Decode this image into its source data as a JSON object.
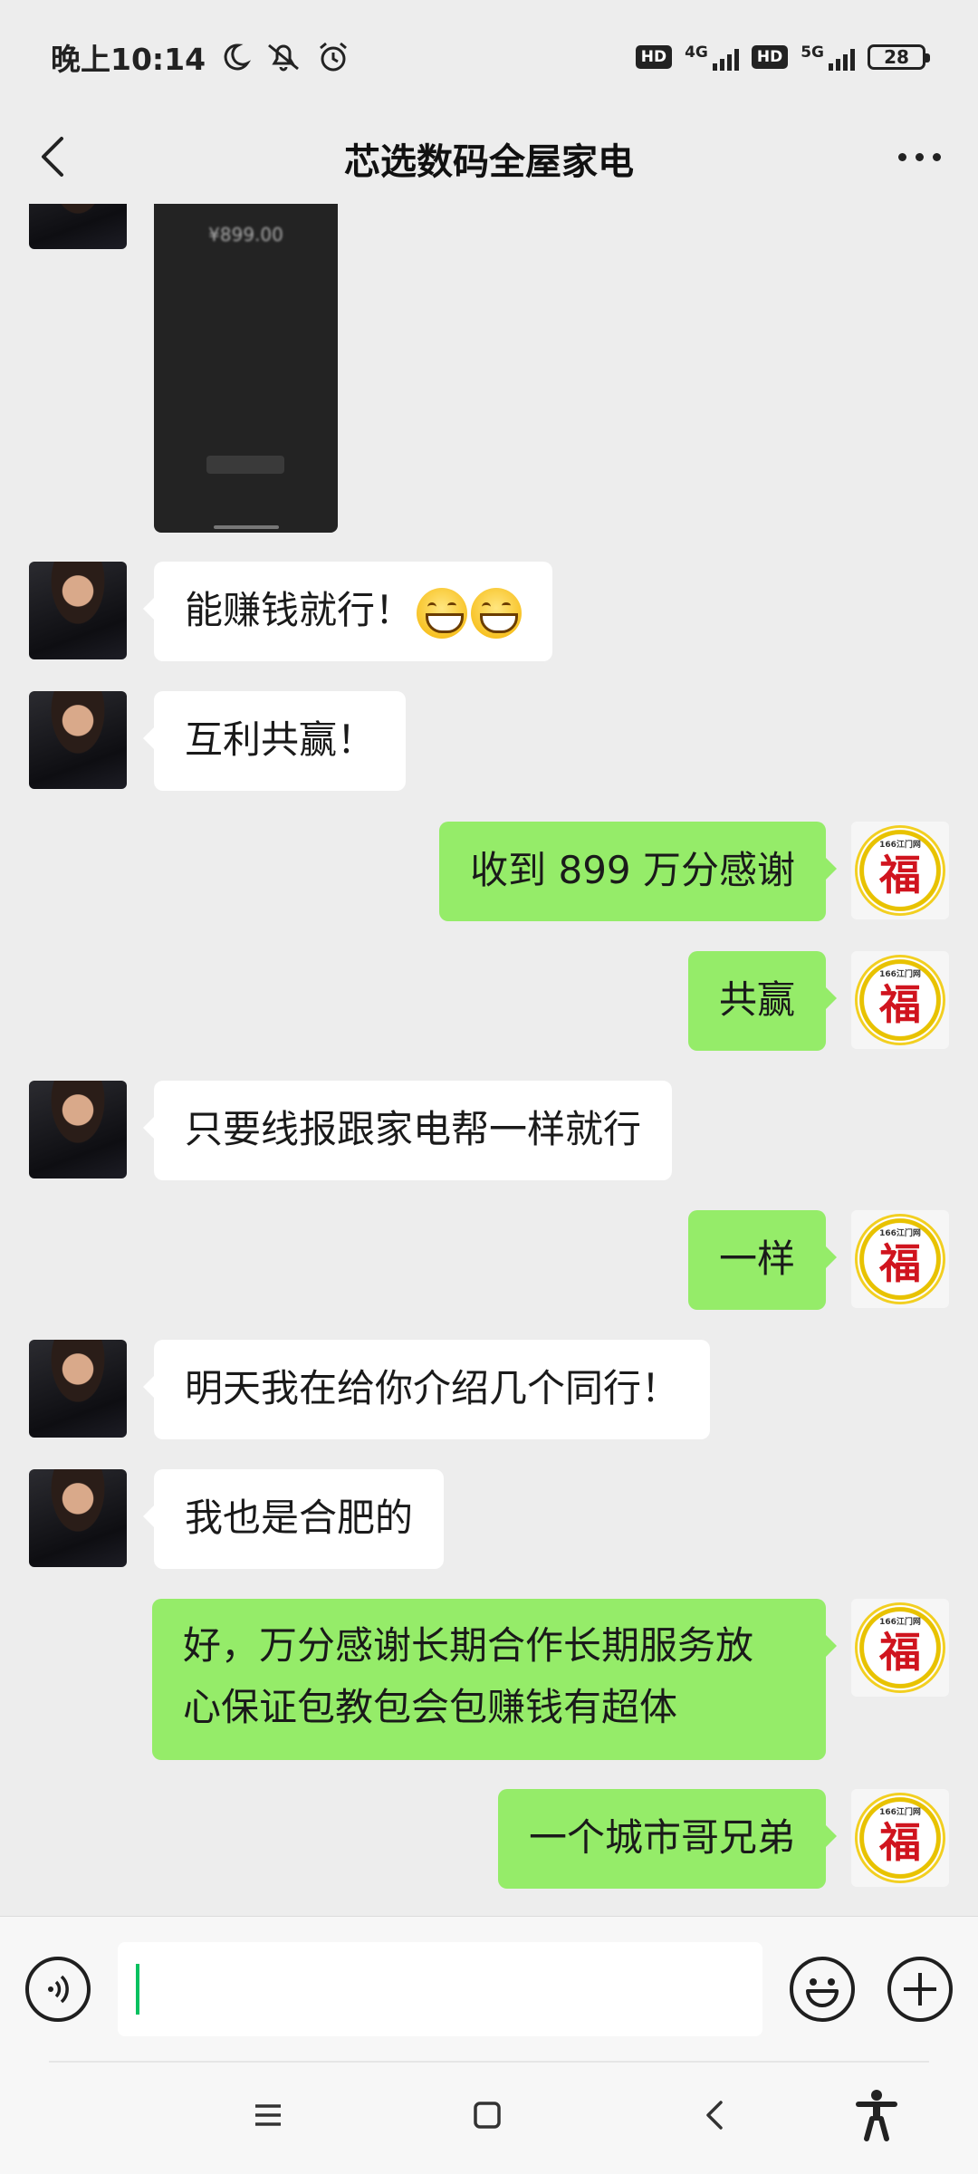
{
  "status_bar": {
    "time": "晚上10:14",
    "network_1": "4G",
    "network_2": "5G",
    "hd_label": "HD",
    "battery": "28"
  },
  "header": {
    "title": "芯选数码全屋家电"
  },
  "avatars": {
    "fu_caption": "166江门网",
    "fu_char": "福"
  },
  "shared_image": {
    "amount_text": "¥899.00"
  },
  "messages": [
    {
      "side": "left",
      "text": "能赚钱就行！",
      "emoji_count": 2
    },
    {
      "side": "left",
      "text": "互利共赢！"
    },
    {
      "side": "right",
      "text": "收到 899 万分感谢"
    },
    {
      "side": "right",
      "text": "共赢"
    },
    {
      "side": "left",
      "text": "只要线报跟家电帮一样就行"
    },
    {
      "side": "right",
      "text": "一样"
    },
    {
      "side": "left",
      "text": "明天我在给你介绍几个同行！"
    },
    {
      "side": "left",
      "text": "我也是合肥的"
    },
    {
      "side": "right",
      "text_line1": "好，万分感谢长期合作长期服务放",
      "text_line2": "心保证包教包会包赚钱有超体"
    },
    {
      "side": "right",
      "text": "一个城市哥兄弟"
    }
  ],
  "input": {
    "value": ""
  },
  "icons": {
    "back": "chevron-left-icon",
    "more": "more-dots-icon",
    "voice": "voice-icon",
    "emoji": "emoji-icon",
    "plus": "plus-icon",
    "nav_menu": "menu-icon",
    "nav_home": "home-square-icon",
    "nav_back": "nav-back-icon",
    "accessibility": "accessibility-icon"
  },
  "colors": {
    "chat_bg": "#ededed",
    "sent_bubble": "#95ec69",
    "received_bubble": "#ffffff",
    "caret": "#07c160"
  }
}
